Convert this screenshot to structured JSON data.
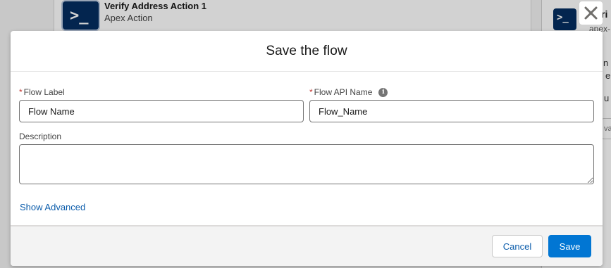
{
  "background": {
    "node_title": "Verify Address Action 1",
    "node_subtitle": "Apex Action",
    "node_icon": "apex-action-icon",
    "panel_title_fragment": "ri",
    "panel_subtitle_fragment": "apex-",
    "panel_text_fragments": [
      "n e",
      "e",
      "u"
    ],
    "panel_input_fragment": "va"
  },
  "modal": {
    "title": "Save the flow",
    "close_icon": "close-icon",
    "fields": {
      "flow_label": {
        "label": "Flow Label",
        "required_marker": "*",
        "value": "Flow Name"
      },
      "flow_api_name": {
        "label": "Flow API Name",
        "required_marker": "*",
        "value": "Flow_Name",
        "help_icon": "info-icon"
      },
      "description": {
        "label": "Description",
        "value": ""
      }
    },
    "show_advanced_label": "Show Advanced",
    "footer": {
      "cancel_label": "Cancel",
      "save_label": "Save"
    }
  },
  "colors": {
    "brand": "#0176d3",
    "link": "#0b5cab",
    "required": "#c23934",
    "tile": "#032d60"
  }
}
